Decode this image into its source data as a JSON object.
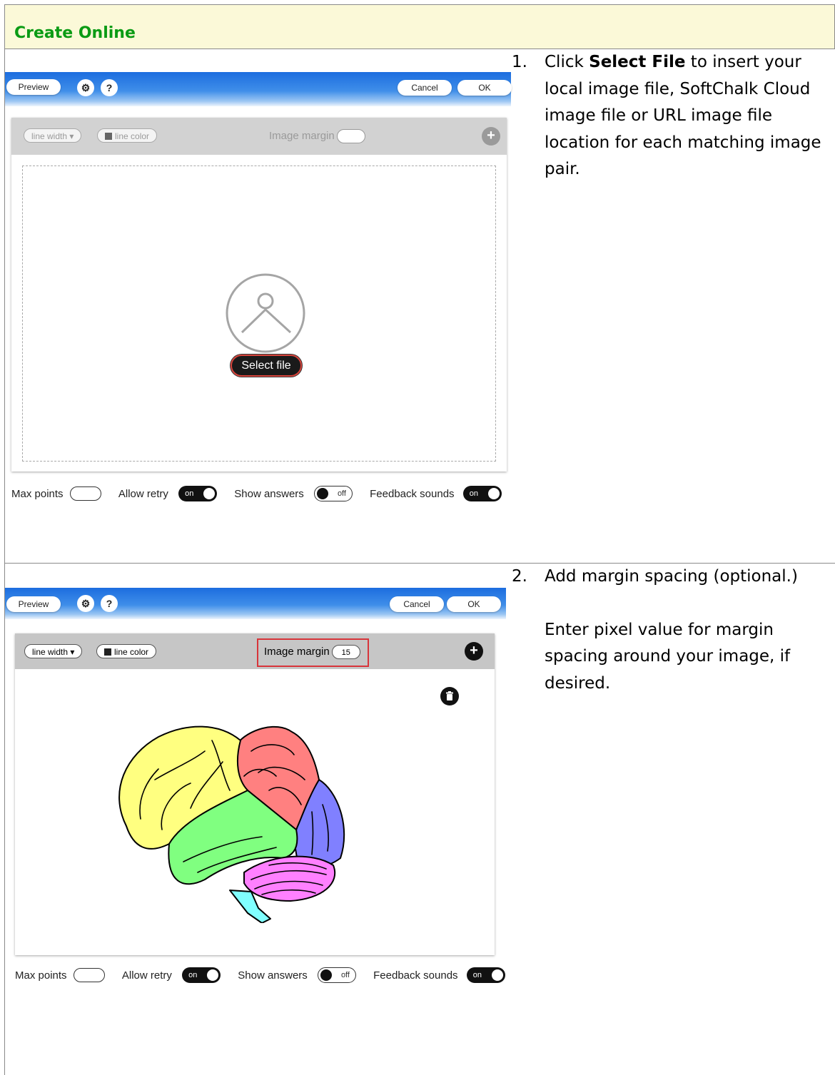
{
  "header": {
    "title": "Create Online"
  },
  "steps": [
    {
      "number": "1.",
      "paragraphs": [
        {
          "before": "Click ",
          "bold": "Select File",
          "after": " to insert your local image file, SoftChalk Cloud image file or URL image file location for each matching image pair."
        }
      ],
      "editor": {
        "preview_label": "Preview",
        "gear_icon": "gear-icon",
        "help_label": "?",
        "cancel_label": "Cancel",
        "ok_label": "OK",
        "line_width_label": "line width ▾",
        "line_color_label": "line color",
        "image_margin_label": "Image margin",
        "image_margin_value": "",
        "add_label": "+",
        "select_file_label": "Select file",
        "settings": {
          "max_points_label": "Max points",
          "allow_retry_label": "Allow retry",
          "allow_retry_state": "on",
          "show_answers_label": "Show answers",
          "show_answers_state": "off",
          "feedback_sounds_label": "Feedback sounds",
          "feedback_sounds_state": "on"
        }
      }
    },
    {
      "number": "2.",
      "paragraphs": [
        {
          "text": "Add margin spacing (optional.)"
        },
        {
          "text": "Enter pixel value for margin spacing around your image, if desired."
        }
      ],
      "editor": {
        "preview_label": "Preview",
        "gear_icon": "gear-icon",
        "help_label": "?",
        "cancel_label": "Cancel",
        "ok_label": "OK",
        "line_width_label": "line width ▾",
        "line_color_label": "line color",
        "image_margin_label": "Image margin",
        "image_margin_value": "15",
        "add_label": "+",
        "image": "brain-diagram",
        "brain_colors": {
          "frontal": "#ffff80",
          "parietal": "#ff8080",
          "occipital": "#8080ff",
          "temporal": "#80ff80",
          "cerebellum": "#ff80ff",
          "brainstem": "#80ffff"
        },
        "settings": {
          "max_points_label": "Max points",
          "allow_retry_label": "Allow retry",
          "allow_retry_state": "on",
          "show_answers_label": "Show answers",
          "show_answers_state": "off",
          "feedback_sounds_label": "Feedback sounds",
          "feedback_sounds_state": "on"
        }
      }
    }
  ]
}
